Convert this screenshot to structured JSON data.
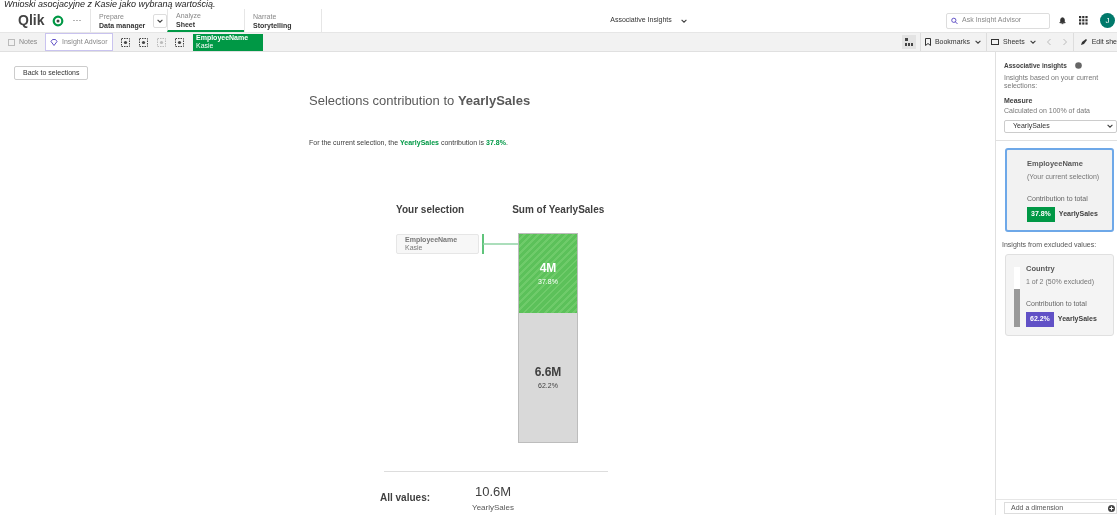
{
  "caption": "Wnioski asocjacyjne z Kasie jako wybraną wartością.",
  "header": {
    "logo": "Qlik",
    "more": "···",
    "nav": [
      {
        "label": "Prepare",
        "value": "Data manager",
        "selected": false,
        "dropdown": true
      },
      {
        "label": "Analyze",
        "value": "Sheet",
        "selected": true,
        "dropdown": false
      },
      {
        "label": "Narrate",
        "value": "Storytelling",
        "selected": false,
        "dropdown": false
      }
    ],
    "title": "Associative Insights",
    "search": {
      "placeholder": "Ask Insight Advisor"
    },
    "avatar": "J"
  },
  "toolbar": {
    "notes": "Notes",
    "advisor": "Insight Advisor",
    "chip": {
      "field": "EmployeeName",
      "value": "Kasie"
    },
    "bookmarks": "Bookmarks",
    "sheets": "Sheets",
    "edit": "Edit she"
  },
  "back": "Back to selections",
  "main": {
    "title": "Selections contribution to **YearlySales**",
    "sentence": "For the current selection, the **YearlySales** contribution is **37.8%**.",
    "col_left": "Your selection",
    "col_right": "Sum of YearlySales",
    "selection": {
      "field": "EmployeeName",
      "value": "Kasie"
    },
    "bar": {
      "level": 0.378,
      "selection": {
        "value": "4M",
        "percent": "37.8%"
      },
      "rest": {
        "value": "6.6M",
        "percent": "62.2%"
      }
    },
    "all_label": "All values:",
    "all_value": "10.6M",
    "all_measure": "YearlySales"
  },
  "panel": {
    "title": "Associative insights",
    "subtitle": "Insights based on your current selections:",
    "measure_label": "Measure",
    "measure_note": "Calculated on 100% of data",
    "measure_value": "YearlySales",
    "cards": [
      {
        "selected": true,
        "kind": "current",
        "field": "EmployeeName",
        "note": "(Your current selection)",
        "contrib": "Contribution to total",
        "badge": "37.8%",
        "color": "#009845",
        "measure": "YearlySales"
      }
    ],
    "excluded_title": "Insights from excluded values:",
    "excluded": [
      {
        "selected": false,
        "kind": "excluded",
        "field": "Country",
        "note": "1 of 2 (50% excluded)",
        "contrib": "Contribution to total",
        "badge": "62.2%",
        "color": "#6151c6",
        "measure": "YearlySales",
        "level": 0.622
      }
    ],
    "add": "Add a dimension"
  }
}
